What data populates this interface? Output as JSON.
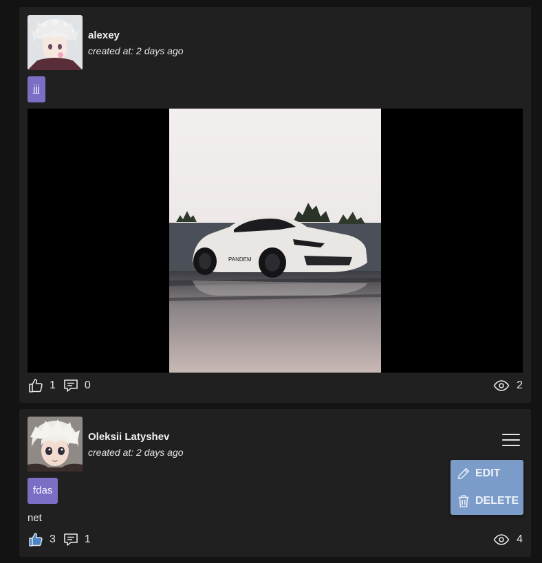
{
  "posts": [
    {
      "author": "alexey",
      "created": "created at: 2 days ago",
      "tag": "jjj",
      "likes": "1",
      "comments": "0",
      "views": "2",
      "liked": false
    },
    {
      "author": "Oleksii Latyshev",
      "created": "created at: 2 days ago",
      "tag": "fdas",
      "text": "net",
      "likes": "3",
      "comments": "1",
      "views": "4",
      "liked": true,
      "menu": {
        "edit_label": "EDIT",
        "delete_label": "DELETE"
      }
    }
  ],
  "colors": {
    "tag": "#7a6fc4",
    "menu": "#7b9cc9",
    "liked": "#4a84c8"
  }
}
